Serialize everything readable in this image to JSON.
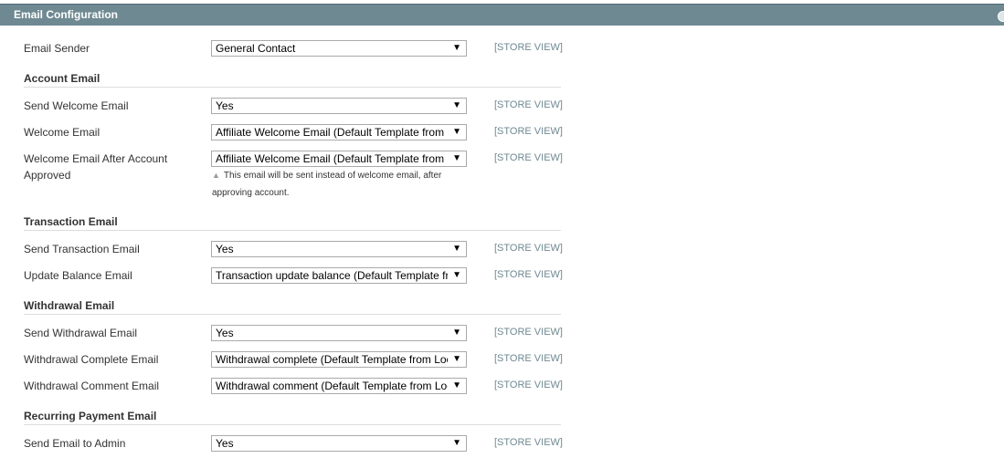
{
  "section": {
    "title": "Email Configuration"
  },
  "scope_label": "[STORE VIEW]",
  "arrow_glyph": "▼",
  "note_glyph": "▲",
  "rows": [
    {
      "label": "Email Sender",
      "value": "General Contact"
    },
    {
      "label": "Send Welcome Email",
      "value": "Yes"
    },
    {
      "label": "Welcome Email",
      "value": "Affiliate Welcome Email (Default Template from Locale)"
    },
    {
      "label": "Welcome Email After Account Approved",
      "value": "Affiliate Welcome Email (Default Template from Locale)"
    },
    {
      "label": "Send Transaction Email",
      "value": "Yes"
    },
    {
      "label": "Update Balance Email",
      "value": "Transaction update balance (Default Template from Locale)"
    },
    {
      "label": "Send Withdrawal Email",
      "value": "Yes"
    },
    {
      "label": "Withdrawal Complete Email",
      "value": "Withdrawal complete (Default Template from Locale)"
    },
    {
      "label": "Withdrawal Comment Email",
      "value": "Withdrawal comment (Default Template from Locale)"
    },
    {
      "label": "Send Email to Admin",
      "value": "Yes"
    }
  ],
  "groups": [
    {
      "title": "Account Email"
    },
    {
      "title": "Transaction Email"
    },
    {
      "title": "Withdrawal Email"
    },
    {
      "title": "Recurring Payment Email"
    }
  ],
  "notes": {
    "welcome_after_approved": "This email will be sent instead of welcome email, after approving account."
  }
}
